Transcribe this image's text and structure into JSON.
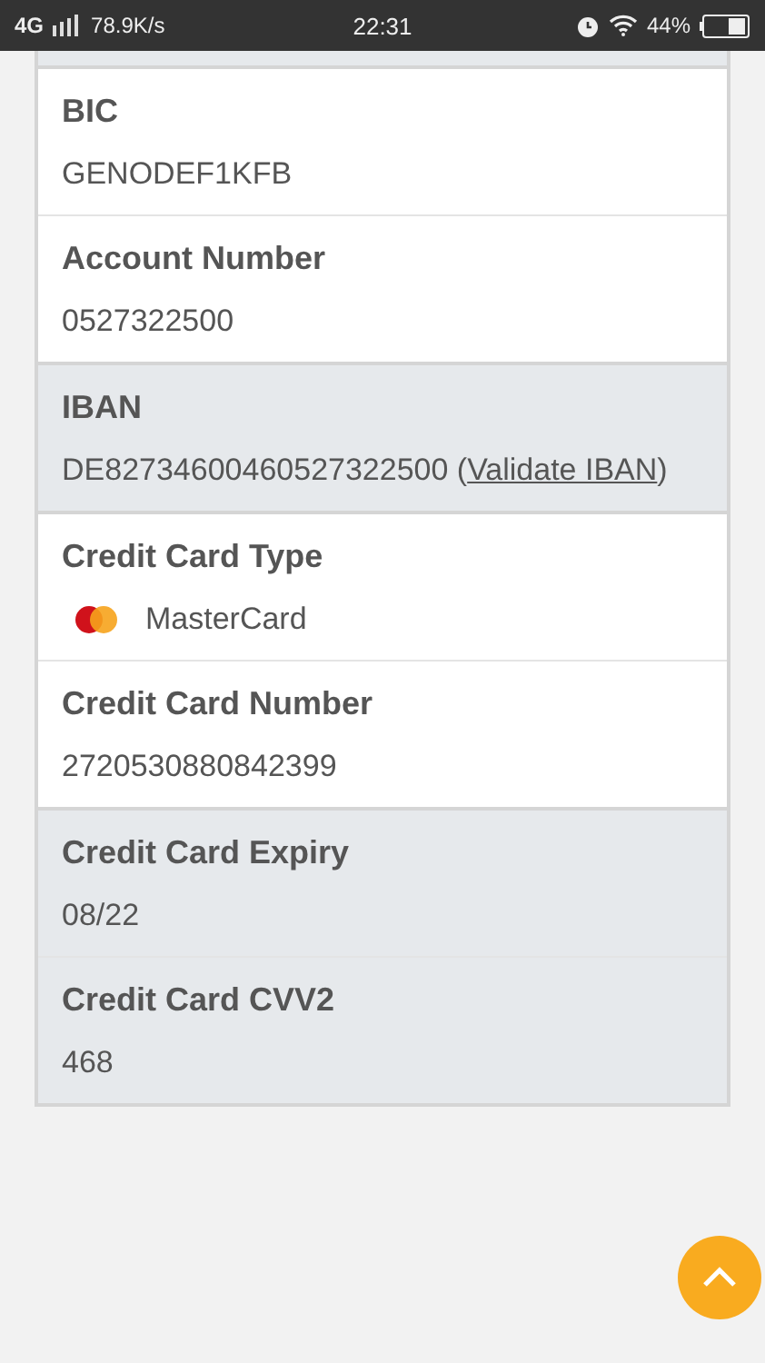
{
  "status_bar": {
    "network": "4G",
    "speed": "78.9K/s",
    "time": "22:31",
    "battery": "44%"
  },
  "groups": [
    {
      "shaded": false,
      "fields": [
        {
          "kind": "text",
          "label": "BIC",
          "value": "GENODEF1KFB"
        },
        {
          "kind": "text",
          "label": "Account Number",
          "value": "0527322500"
        }
      ]
    },
    {
      "shaded": true,
      "fields": [
        {
          "kind": "link",
          "label": "IBAN",
          "value": "DE82734600460527322500 (",
          "link": "Validate IBAN",
          "suffix": ")"
        }
      ]
    },
    {
      "shaded": false,
      "fields": [
        {
          "kind": "card",
          "label": "Credit Card Type",
          "value": "MasterCard"
        },
        {
          "kind": "text",
          "label": "Credit Card Number",
          "value": "2720530880842399"
        }
      ]
    },
    {
      "shaded": true,
      "fields": [
        {
          "kind": "text",
          "label": "Credit Card Expiry",
          "value": "08/22"
        },
        {
          "kind": "text",
          "label": "Credit Card CVV2",
          "value": "468"
        }
      ]
    }
  ]
}
